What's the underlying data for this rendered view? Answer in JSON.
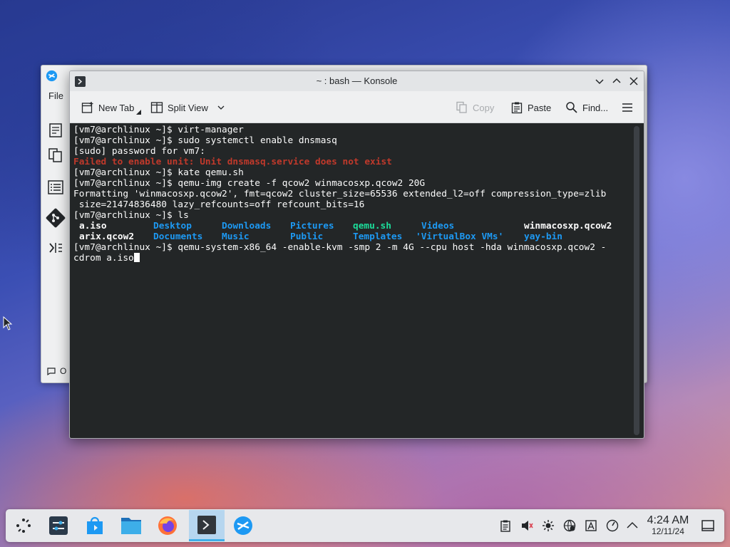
{
  "background_window": {
    "menu_file": "File",
    "status_partial": "O",
    "sidebar_icons": [
      "documents-icon",
      "list-icon",
      "git-icon",
      "terminal-icon"
    ]
  },
  "konsole": {
    "title": "~ : bash — Konsole",
    "toolbar": {
      "new_tab": "New Tab",
      "split_view": "Split View",
      "copy": "Copy",
      "paste": "Paste",
      "find": "Find..."
    },
    "terminal": {
      "lines": [
        "[vm7@archlinux ~]$ virt-manager",
        "[vm7@archlinux ~]$ sudo systemctl enable dnsmasq",
        "[sudo] password for vm7:",
        "Failed to enable unit: Unit dnsmasq.service does not exist",
        "[vm7@archlinux ~]$ kate qemu.sh",
        "[vm7@archlinux ~]$ qemu-img create -f qcow2 winmacosxp.qcow2 20G",
        "Formatting 'winmacosxp.qcow2', fmt=qcow2 cluster_size=65536 extended_l2=off compression_type=zlib",
        " size=21474836480 lazy_refcounts=off refcount_bits=16",
        "[vm7@archlinux ~]$ ls"
      ],
      "ls_rows": [
        [
          {
            "text": "a.iso",
            "color": "#fcfcfc"
          },
          {
            "text": "Desktop",
            "color": "#1d99f3"
          },
          {
            "text": "Downloads",
            "color": "#1d99f3"
          },
          {
            "text": "Pictures",
            "color": "#1d99f3"
          },
          {
            "text": "qemu.sh",
            "color": "#1cdc9a"
          },
          {
            "text": "Videos",
            "color": "#1d99f3"
          },
          {
            "text": "winmacosxp.qcow2",
            "color": "#fcfcfc"
          }
        ],
        [
          {
            "text": "arix.qcow2",
            "color": "#fcfcfc"
          },
          {
            "text": "Documents",
            "color": "#1d99f3"
          },
          {
            "text": "Music",
            "color": "#1d99f3"
          },
          {
            "text": "Public",
            "color": "#1d99f3"
          },
          {
            "text": "Templates",
            "color": "#1d99f3"
          },
          {
            "text": "'VirtualBox VMs'",
            "color": "#1d99f3"
          },
          {
            "text": "yay-bin",
            "color": "#1d99f3"
          }
        ]
      ],
      "tail_lines": [
        "[vm7@archlinux ~]$ qemu-system-x86_64 -enable-kvm -smp 2 -m 4G --cpu host -hda winmacosxp.qcow2 -",
        "cdrom a.iso"
      ],
      "error_color": "#c0392b"
    }
  },
  "taskbar": {
    "apps": [
      "application-launcher-icon",
      "system-settings-icon",
      "discover-store-icon",
      "file-manager-icon",
      "firefox-icon",
      "konsole-icon",
      "virt-manager-icon"
    ],
    "tray_icons": [
      "clipboard-icon",
      "volume-muted-icon",
      "brightness-icon",
      "network-icon",
      "updates-icon",
      "power-profile-icon",
      "tray-expand-icon"
    ],
    "time": "4:24 AM",
    "date": "12/11/24"
  }
}
